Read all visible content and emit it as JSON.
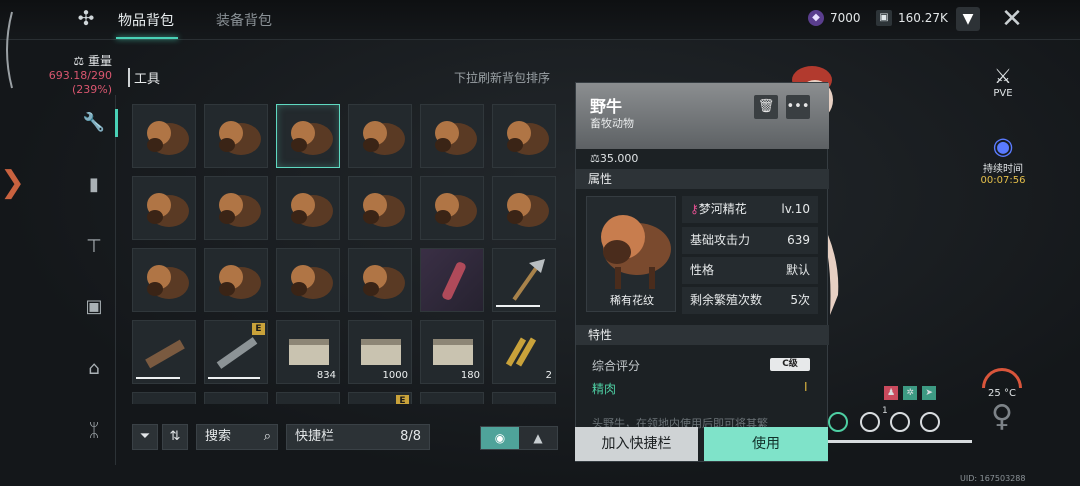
{
  "tabs": [
    "物品背包",
    "装备背包"
  ],
  "currency": [
    {
      "icon": "gem-icon",
      "value": "7000"
    },
    {
      "icon": "chip-icon",
      "value": "160.27K"
    }
  ],
  "weight": {
    "label": "重量",
    "value": "693.18/290",
    "percent": "(239%)"
  },
  "sidebar": [
    {
      "icon": "wrench-icon"
    },
    {
      "icon": "bottle-icon"
    },
    {
      "icon": "tool-icon"
    },
    {
      "icon": "calendar-star-icon"
    },
    {
      "icon": "house-icon"
    },
    {
      "icon": "butterfly-icon"
    }
  ],
  "section": {
    "title": "工具",
    "hint": "下拉刷新背包排序"
  },
  "grid_counts": {
    "ammo1": "834",
    "ammo2": "1000",
    "ammo3": "180",
    "bullets": "2"
  },
  "bottom": {
    "search": "搜索",
    "quickbar_label": "快捷栏",
    "quickbar_count": "8/8"
  },
  "panel": {
    "name": "野牛",
    "category": "畜牧动物",
    "price": "35.000",
    "attr_header": "属性",
    "image_caption": "稀有花纹",
    "attrs": [
      {
        "label": "梦河精花",
        "value": "lv.10"
      },
      {
        "label": "基础攻击力",
        "value": "639"
      },
      {
        "label": "性格",
        "value": "默认"
      },
      {
        "label": "剩余繁殖次数",
        "value": "5次"
      }
    ],
    "trait_header": "特性",
    "rating_label": "综合评分",
    "rating_badge": "C级",
    "trait_name": "精肉",
    "trait_level": "I",
    "description": "头野牛，在领地内使用后即可将其繁",
    "btn_add": "加入快捷栏",
    "btn_use": "使用"
  },
  "right": {
    "pve": "PVE",
    "duration_label": "持续时间",
    "duration_value": "00:07:56",
    "temperature": "25 °C",
    "status_number": "1",
    "uid": "UID: 167503288"
  }
}
